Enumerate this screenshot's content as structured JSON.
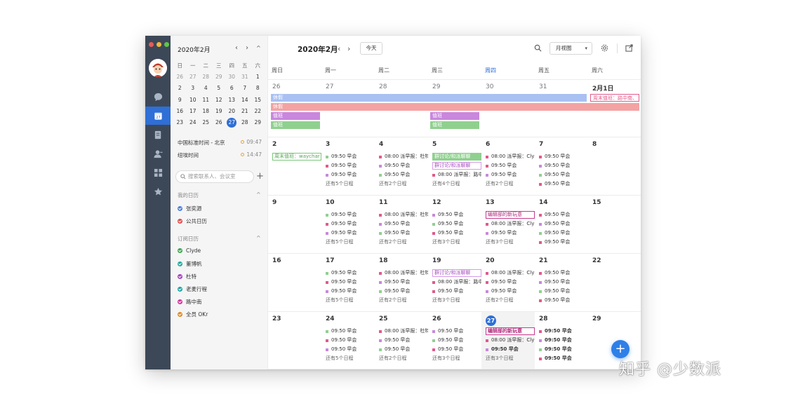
{
  "sidebar": {
    "mini_calendar": {
      "title": "2020年2月",
      "prev": "‹",
      "next": "›",
      "collapse": "^",
      "weekday_headers": [
        "日",
        "一",
        "二",
        "三",
        "四",
        "五",
        "六"
      ],
      "weeks": [
        [
          "26",
          "27",
          "28",
          "29",
          "30",
          "31",
          "1"
        ],
        [
          "2",
          "3",
          "4",
          "5",
          "6",
          "7",
          "8"
        ],
        [
          "9",
          "10",
          "11",
          "12",
          "13",
          "14",
          "15"
        ],
        [
          "16",
          "17",
          "18",
          "19",
          "20",
          "21",
          "22"
        ],
        [
          "23",
          "24",
          "25",
          "26",
          "27",
          "28",
          "29"
        ]
      ],
      "today": "27"
    },
    "timezones": [
      {
        "label": "中国标准时间 - 北京",
        "time": "09:47"
      },
      {
        "label": "纽埃时间",
        "time": "14:47"
      }
    ],
    "search": {
      "placeholder": "搜索联系人、会议室"
    },
    "add": "+",
    "my_calendars": {
      "title": "我的日历",
      "items": [
        {
          "label": "张奕源",
          "color": "#4a7fd4"
        },
        {
          "label": "公共日历",
          "color": "#e04b4b"
        }
      ]
    },
    "subscribed": {
      "title": "订阅日历",
      "items": [
        {
          "label": "Clyde",
          "color": "#3aa84c"
        },
        {
          "label": "董博帆",
          "color": "#20a99a"
        },
        {
          "label": "杜特",
          "color": "#a43fc1"
        },
        {
          "label": "老麦行程",
          "color": "#1fa4a0"
        },
        {
          "label": "路中南",
          "color": "#d1349a"
        },
        {
          "label": "全员 OKr",
          "color": "#e08a1c"
        }
      ]
    }
  },
  "toolbar": {
    "title": "2020年2月",
    "prev": "‹",
    "next": "›",
    "today_button": "今天",
    "view_select": "月视图",
    "view_caret": "▾"
  },
  "weekdays": [
    "周日",
    "周一",
    "周二",
    "周三",
    "周四",
    "周五",
    "周六"
  ],
  "weeks": [
    {
      "days": [
        "26",
        "27",
        "28",
        "29",
        "30",
        "31",
        "2月1日"
      ],
      "allday": [
        {
          "label": "休假",
          "color": "#a9c1f2"
        },
        {
          "label": "休假",
          "color": "#f4a3a3"
        },
        {
          "label": "值班",
          "color": "#c987dd"
        },
        {
          "label": "值班",
          "color": "#8fd08f"
        },
        {
          "label": "值班",
          "color": "#c987dd"
        },
        {
          "label": "值班",
          "color": "#8fd08f"
        },
        {
          "label": "周末值班：路中南、",
          "color": "#e05a8a"
        }
      ]
    },
    {
      "days": [
        "2",
        "3",
        "4",
        "5",
        "6",
        "7",
        "8"
      ],
      "events": [
        [
          {
            "label": "周末值班：waychar",
            "style": "boxed",
            "color": "#7bc77b"
          }
        ],
        [
          {
            "label": "09:50 早会"
          },
          {
            "label": "09:50 早会"
          },
          {
            "label": "09:50 早会"
          }
        ],
        [
          {
            "label": "08:00 派早报：杜特"
          },
          {
            "label": "09:50 早会"
          },
          {
            "label": "09:50 早会"
          }
        ],
        [
          {
            "label": "群讨论/和派聊聊"
          },
          {
            "label": "群讨论/和派聊聊"
          },
          {
            "label": "08:00 派早报：路中"
          }
        ],
        [
          {
            "label": "08:00 派早报：Cly"
          },
          {
            "label": "09:50 早会"
          },
          {
            "label": "09:50 早会"
          }
        ],
        [
          {
            "label": "09:50 早会"
          },
          {
            "label": "09:50 早会"
          },
          {
            "label": "09:50 早会"
          },
          {
            "label": "09:50 早会"
          }
        ],
        []
      ],
      "more": [
        "",
        "还有5个日程",
        "还有2个日程",
        "还有4个日程",
        "还有2个日程",
        "",
        ""
      ]
    },
    {
      "days": [
        "9",
        "10",
        "11",
        "12",
        "13",
        "14",
        "15"
      ],
      "events": [
        [],
        [
          {
            "label": "09:50 早会"
          },
          {
            "label": "09:50 早会"
          },
          {
            "label": "09:50 早会"
          }
        ],
        [
          {
            "label": "08:00 派早报：杜特"
          },
          {
            "label": "09:50 早会"
          },
          {
            "label": "09:50 早会"
          }
        ],
        [
          {
            "label": "09:50 早会"
          },
          {
            "label": "09:50 早会"
          },
          {
            "label": "09:50 早会"
          }
        ],
        [
          {
            "label": "编辑部的新玩意"
          },
          {
            "label": "08:00 派早报：Cly"
          },
          {
            "label": "09:50 早会"
          }
        ],
        [
          {
            "label": "09:50 早会"
          },
          {
            "label": "09:50 早会"
          },
          {
            "label": "09:50 早会"
          },
          {
            "label": "09:50 早会"
          }
        ],
        []
      ],
      "more": [
        "",
        "还有5个日程",
        "还有2个日程",
        "还有3个日程",
        "还有3个日程",
        "",
        ""
      ]
    },
    {
      "days": [
        "16",
        "17",
        "18",
        "19",
        "20",
        "21",
        "22"
      ],
      "events": [
        [],
        [
          {
            "label": "09:50 早会"
          },
          {
            "label": "09:50 早会"
          },
          {
            "label": "09:50 早会"
          }
        ],
        [
          {
            "label": "08:00 派早报：杜特"
          },
          {
            "label": "09:50 早会"
          },
          {
            "label": "09:50 早会"
          }
        ],
        [
          {
            "label": "群讨论/和派聊聊"
          },
          {
            "label": "08:00 派早报：路中"
          },
          {
            "label": "09:50 早会"
          }
        ],
        [
          {
            "label": "08:00 派早报：Cly"
          },
          {
            "label": "09:50 早会"
          },
          {
            "label": "09:50 早会"
          }
        ],
        [
          {
            "label": "09:50 早会"
          },
          {
            "label": "09:50 早会"
          },
          {
            "label": "09:50 早会"
          },
          {
            "label": "09:50 早会"
          }
        ],
        []
      ],
      "more": [
        "",
        "还有5个日程",
        "还有2个日程",
        "还有3个日程",
        "还有2个日程",
        "",
        ""
      ]
    },
    {
      "days": [
        "23",
        "24",
        "25",
        "26",
        "27",
        "28",
        "29"
      ],
      "events": [
        [],
        [
          {
            "label": "09:50 早会"
          },
          {
            "label": "09:50 早会"
          },
          {
            "label": "09:50 早会"
          }
        ],
        [
          {
            "label": "08:00 派早报：杜特"
          },
          {
            "label": "09:50 早会"
          },
          {
            "label": "09:50 早会"
          }
        ],
        [
          {
            "label": "09:50 早会"
          },
          {
            "label": "09:50 早会"
          },
          {
            "label": "09:50 早会"
          }
        ],
        [
          {
            "label": "编辑部的新玩意"
          },
          {
            "label": "08:00 派早报：Cly"
          },
          {
            "label": "09:50 早会"
          }
        ],
        [
          {
            "label": "09:50 早会"
          },
          {
            "label": "09:50 早会"
          },
          {
            "label": "09:50 早会"
          },
          {
            "label": "09:50 早会"
          }
        ],
        []
      ],
      "more": [
        "",
        "还有5个日程",
        "还有2个日程",
        "还有3个日程",
        "还有3个日程",
        "",
        ""
      ]
    }
  ],
  "fab": "+",
  "watermark": "知乎 @少数派"
}
